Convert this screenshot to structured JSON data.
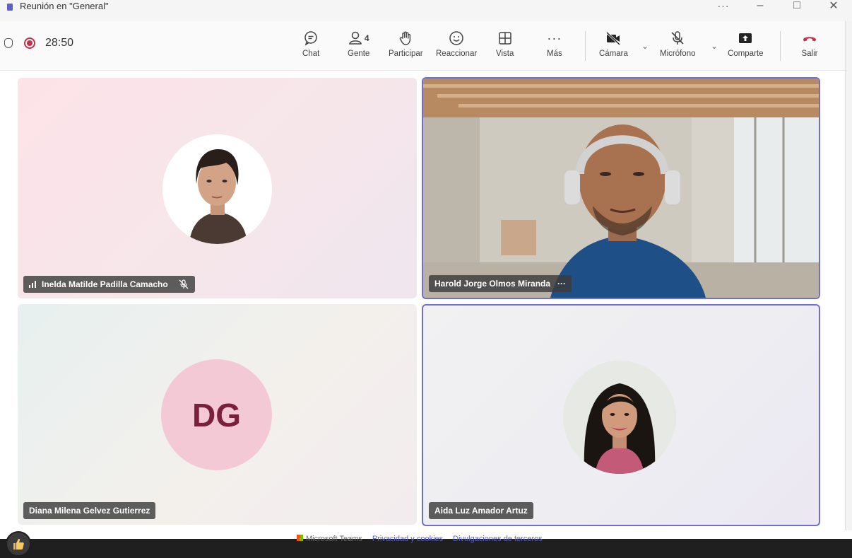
{
  "window": {
    "title": "Reunión en \"General\"",
    "controls": {
      "more": "···",
      "minimize": "–",
      "maximize": "□",
      "close": "✕"
    }
  },
  "toolbar": {
    "timer": "28:50",
    "people_count": "4",
    "chat_label": "Chat",
    "people_label": "Gente",
    "raise_hand_label": "Participar",
    "react_label": "Reaccionar",
    "view_label": "Vista",
    "more_label": "Más",
    "camera_label": "Cámara",
    "mic_label": "Micrófono",
    "share_label": "Comparte",
    "leave_label": "Salir"
  },
  "participants": [
    {
      "name": "Inelda Matilde Padilla Camacho",
      "muted": true
    },
    {
      "name": "Harold Jorge Olmos Miranda",
      "more": "···"
    },
    {
      "name": "Diana Milena Gelvez Gutierrez",
      "initials": "DG"
    },
    {
      "name": "Aida Luz Amador Artuz"
    }
  ],
  "footer": {
    "app": "Microsoft Teams",
    "privacy": "Privacidad y cookies",
    "third_party": "Divulgaciones de terceros"
  },
  "colors": {
    "accent": "#6f6fd0",
    "recording": "#c4314b",
    "leave": "#c4314b",
    "initials_bg": "#f3c9d6",
    "initials_text": "#7a1f3d"
  }
}
